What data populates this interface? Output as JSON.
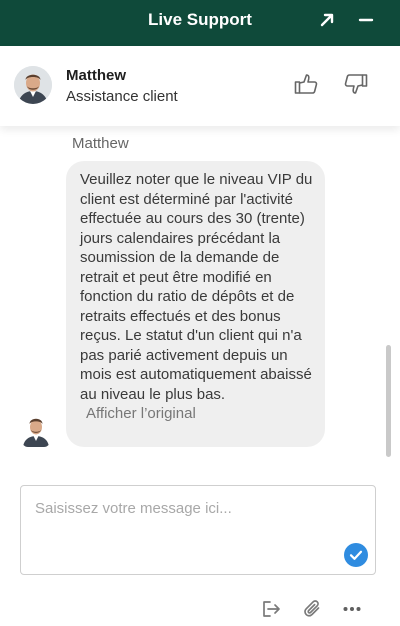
{
  "header": {
    "title": "Live Support",
    "colors": {
      "background": "#0f4a3a",
      "text": "#ffffff"
    },
    "icons": {
      "expand": "arrow-up-right-icon",
      "minimize": "minimize-icon"
    }
  },
  "agent": {
    "name": "Matthew",
    "role": "Assistance client",
    "icons": {
      "rate_up": "thumbs-up-icon",
      "rate_down": "thumbs-down-icon"
    }
  },
  "conversation": {
    "messages": [
      {
        "sender": "Matthew",
        "text": "Veuillez noter que le niveau VIP du client est déterminé par l'activité effectuée au cours des 30 (trente) jours calendaires précédant la soumission de la demande de retrait et peut être modifié en fonction du ratio de dépôts et de retraits effectués et des bonus reçus. Le statut d'un client qui n'a pas parié activement depuis un mois est automatiquement abaissé au niveau le plus bas.",
        "show_original_label": "Afficher l’original"
      }
    ]
  },
  "composer": {
    "placeholder": "Saisissez votre message ici...",
    "value": "",
    "send_color": "#2f8ce0"
  },
  "toolbar": {
    "icons": [
      "exit-icon",
      "paperclip-icon",
      "more-icon"
    ]
  }
}
